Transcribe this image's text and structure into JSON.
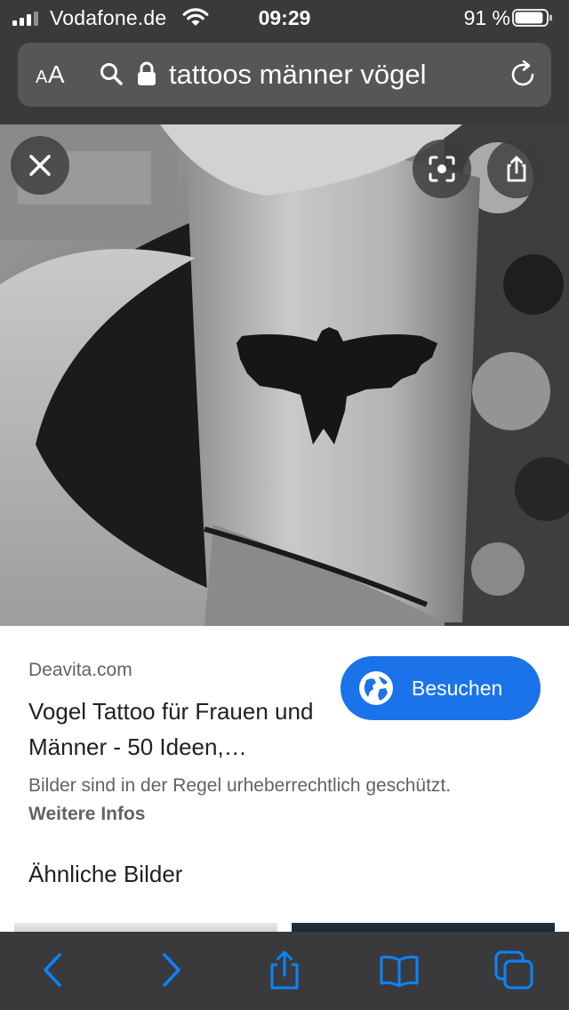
{
  "status_bar": {
    "carrier": "Vodafone.de",
    "time": "09:29",
    "battery_percent": "91 %",
    "battery_level": 0.91
  },
  "url_bar": {
    "text_size_label": "AA",
    "query": "tattoos männer vögel",
    "icons": [
      "search-icon",
      "lock-icon",
      "reload-icon"
    ]
  },
  "image_viewer": {
    "buttons": [
      "close-icon",
      "lens-icon",
      "share-icon"
    ]
  },
  "result": {
    "source": "Deavita.com",
    "title": "Vogel Tattoo für Frauen und Männer - 50 Ideen,…",
    "visit_label": "Besuchen",
    "copyright_notice": "Bilder sind in der Regel urheberrechtlich geschützt.",
    "more_info_label": "Weitere Infos",
    "similar_images_label": "Ähnliche Bilder"
  },
  "toolbar": {
    "icons": [
      "back-icon",
      "forward-icon",
      "share-icon",
      "bookmarks-icon",
      "tabs-icon"
    ],
    "accent_color": "#0a84ff"
  },
  "colors": {
    "chrome_background": "#3a3a3c",
    "url_field": "#565658",
    "visit_button": "#1a73e8"
  }
}
